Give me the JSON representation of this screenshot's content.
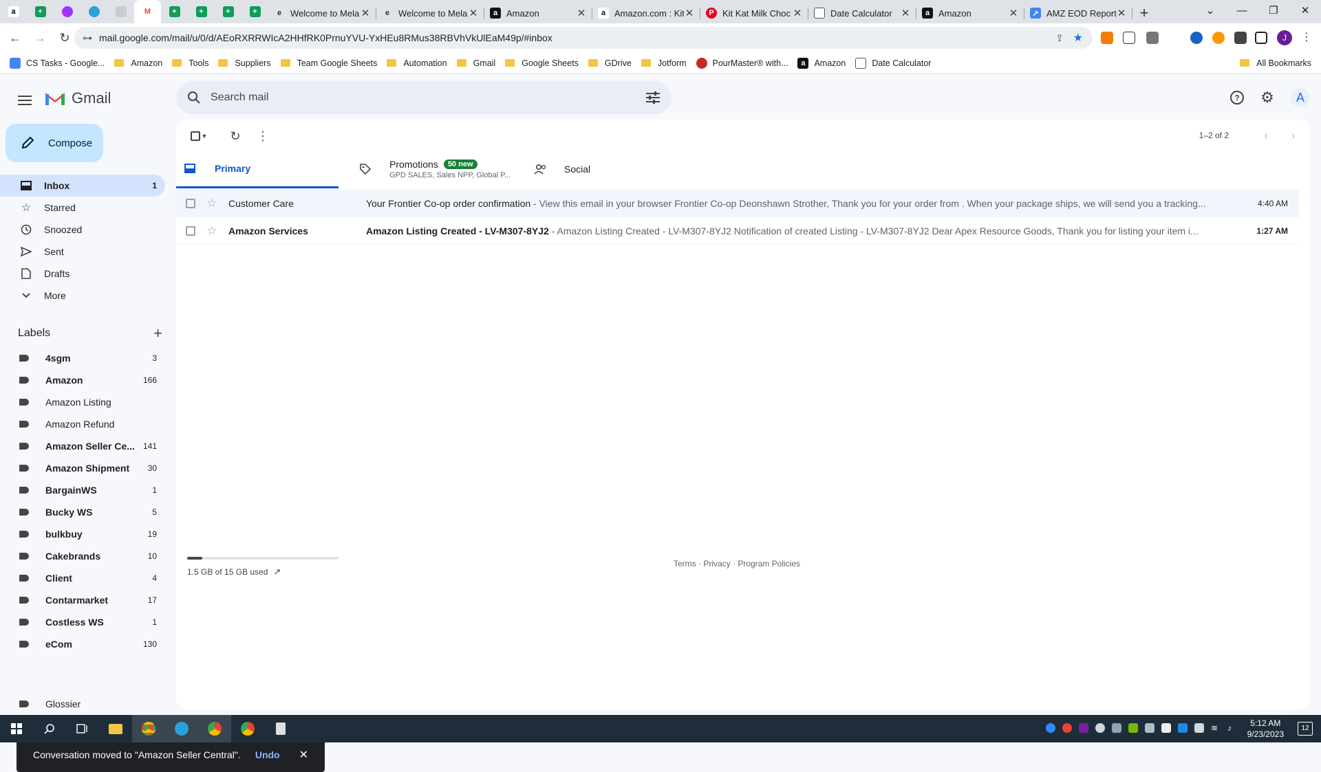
{
  "browser": {
    "tabs": [
      {
        "title": "Welcome to Mela",
        "icon": "melaleuca-icon"
      },
      {
        "title": "Welcome to Mela",
        "icon": "melaleuca-icon"
      },
      {
        "title": "Amazon",
        "icon": "amazon-icon"
      },
      {
        "title": "Amazon.com : Kit",
        "icon": "amazon-icon"
      },
      {
        "title": "Kit Kat Milk Choc",
        "icon": "pinterest-icon"
      },
      {
        "title": "Date Calculator",
        "icon": "calculator-icon"
      },
      {
        "title": "Amazon",
        "icon": "amazon-icon"
      },
      {
        "title": "AMZ EOD Report",
        "icon": "report-icon"
      }
    ],
    "url": "mail.google.com/mail/u/0/d/AEoRXRRWIcA2HHfRK0PrnuYVU-YxHEu8RMus38RBVhVkUlEaM49p/#inbox",
    "bookmarks": [
      "CS Tasks - Google...",
      "Amazon",
      "Tools",
      "Suppliers",
      "Team Google Sheets",
      "Automation",
      "Gmail",
      "Google Sheets",
      "GDrive",
      "Jotform",
      "PourMaster® with...",
      "Amazon",
      "Date Calculator"
    ],
    "all_bookmarks": "All Bookmarks",
    "profile_initial": "J"
  },
  "gmail": {
    "logo_text": "Gmail",
    "search_placeholder": "Search mail",
    "avatar_initial": "A",
    "compose": "Compose",
    "nav": [
      {
        "label": "Inbox",
        "count": "1"
      },
      {
        "label": "Starred",
        "count": ""
      },
      {
        "label": "Snoozed",
        "count": ""
      },
      {
        "label": "Sent",
        "count": ""
      },
      {
        "label": "Drafts",
        "count": ""
      },
      {
        "label": "More",
        "count": ""
      }
    ],
    "labels_title": "Labels",
    "labels": [
      {
        "name": "4sgm",
        "count": "3",
        "bold": true
      },
      {
        "name": "Amazon",
        "count": "166",
        "bold": true
      },
      {
        "name": "Amazon Listing",
        "count": "",
        "bold": false
      },
      {
        "name": "Amazon Refund",
        "count": "",
        "bold": false
      },
      {
        "name": "Amazon Seller Ce...",
        "count": "141",
        "bold": true
      },
      {
        "name": "Amazon Shipment",
        "count": "30",
        "bold": true
      },
      {
        "name": "BargainWS",
        "count": "1",
        "bold": true
      },
      {
        "name": "Bucky WS",
        "count": "5",
        "bold": true
      },
      {
        "name": "bulkbuy",
        "count": "19",
        "bold": true
      },
      {
        "name": "Cakebrands",
        "count": "10",
        "bold": true
      },
      {
        "name": "Client",
        "count": "4",
        "bold": true
      },
      {
        "name": "Contarmarket",
        "count": "17",
        "bold": true
      },
      {
        "name": "Costless WS",
        "count": "1",
        "bold": true
      },
      {
        "name": "eCom",
        "count": "130",
        "bold": true
      },
      {
        "name": "Glossier",
        "count": "",
        "bold": false
      }
    ],
    "pager": "1–2 of 2",
    "tabs": {
      "primary": "Primary",
      "promotions": "Promotions",
      "promotions_badge": "50 new",
      "promotions_sub": "GPD SALES, Sales NPP, Global P...",
      "social": "Social"
    },
    "emails": [
      {
        "sender": "Customer Care",
        "subject": "Your Frontier Co-op order confirmation",
        "snippet": " - View this email in your browser Frontier Co-op Deonshawn Strother, Thank you for your order from . When your package ships, we will send you a tracking...",
        "time": "4:40 AM",
        "unread": false
      },
      {
        "sender": "Amazon Services",
        "subject": "Amazon Listing Created - LV-M307-8YJ2",
        "snippet": " - Amazon Listing Created - LV-M307-8YJ2 Notification of created Listing - LV-M307-8YJ2 Dear Apex Resource Goods, Thank you for listing your item i...",
        "time": "1:27 AM",
        "unread": true
      }
    ],
    "storage": "1.5 GB of 15 GB used",
    "storage_fraction": 0.1,
    "footer": "Terms · Privacy · Program Policies",
    "toast": {
      "message": "Conversation moved to \"Amazon Seller Central\".",
      "action": "Undo"
    }
  },
  "taskbar": {
    "time": "5:12 AM",
    "date": "9/23/2023",
    "notifications": "12"
  }
}
